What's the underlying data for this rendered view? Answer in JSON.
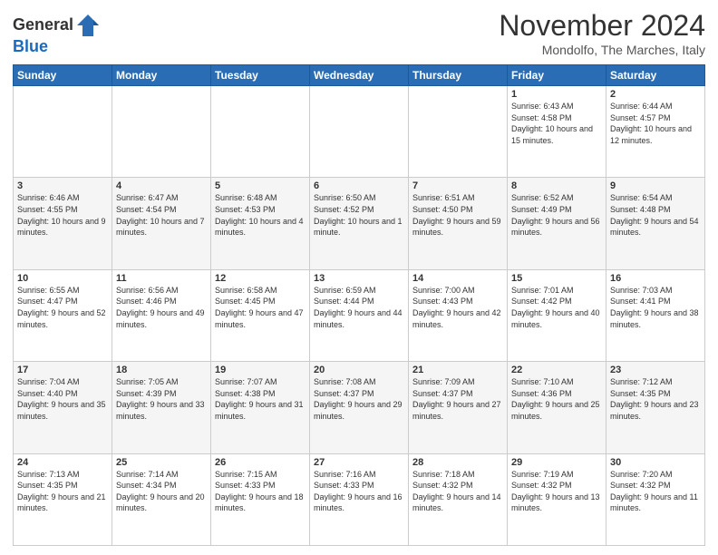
{
  "header": {
    "logo_general": "General",
    "logo_blue": "Blue",
    "month_title": "November 2024",
    "location": "Mondolfo, The Marches, Italy"
  },
  "weekdays": [
    "Sunday",
    "Monday",
    "Tuesday",
    "Wednesday",
    "Thursday",
    "Friday",
    "Saturday"
  ],
  "weeks": [
    [
      {
        "day": "",
        "info": ""
      },
      {
        "day": "",
        "info": ""
      },
      {
        "day": "",
        "info": ""
      },
      {
        "day": "",
        "info": ""
      },
      {
        "day": "",
        "info": ""
      },
      {
        "day": "1",
        "info": "Sunrise: 6:43 AM\nSunset: 4:58 PM\nDaylight: 10 hours and 15 minutes."
      },
      {
        "day": "2",
        "info": "Sunrise: 6:44 AM\nSunset: 4:57 PM\nDaylight: 10 hours and 12 minutes."
      }
    ],
    [
      {
        "day": "3",
        "info": "Sunrise: 6:46 AM\nSunset: 4:55 PM\nDaylight: 10 hours and 9 minutes."
      },
      {
        "day": "4",
        "info": "Sunrise: 6:47 AM\nSunset: 4:54 PM\nDaylight: 10 hours and 7 minutes."
      },
      {
        "day": "5",
        "info": "Sunrise: 6:48 AM\nSunset: 4:53 PM\nDaylight: 10 hours and 4 minutes."
      },
      {
        "day": "6",
        "info": "Sunrise: 6:50 AM\nSunset: 4:52 PM\nDaylight: 10 hours and 1 minute."
      },
      {
        "day": "7",
        "info": "Sunrise: 6:51 AM\nSunset: 4:50 PM\nDaylight: 9 hours and 59 minutes."
      },
      {
        "day": "8",
        "info": "Sunrise: 6:52 AM\nSunset: 4:49 PM\nDaylight: 9 hours and 56 minutes."
      },
      {
        "day": "9",
        "info": "Sunrise: 6:54 AM\nSunset: 4:48 PM\nDaylight: 9 hours and 54 minutes."
      }
    ],
    [
      {
        "day": "10",
        "info": "Sunrise: 6:55 AM\nSunset: 4:47 PM\nDaylight: 9 hours and 52 minutes."
      },
      {
        "day": "11",
        "info": "Sunrise: 6:56 AM\nSunset: 4:46 PM\nDaylight: 9 hours and 49 minutes."
      },
      {
        "day": "12",
        "info": "Sunrise: 6:58 AM\nSunset: 4:45 PM\nDaylight: 9 hours and 47 minutes."
      },
      {
        "day": "13",
        "info": "Sunrise: 6:59 AM\nSunset: 4:44 PM\nDaylight: 9 hours and 44 minutes."
      },
      {
        "day": "14",
        "info": "Sunrise: 7:00 AM\nSunset: 4:43 PM\nDaylight: 9 hours and 42 minutes."
      },
      {
        "day": "15",
        "info": "Sunrise: 7:01 AM\nSunset: 4:42 PM\nDaylight: 9 hours and 40 minutes."
      },
      {
        "day": "16",
        "info": "Sunrise: 7:03 AM\nSunset: 4:41 PM\nDaylight: 9 hours and 38 minutes."
      }
    ],
    [
      {
        "day": "17",
        "info": "Sunrise: 7:04 AM\nSunset: 4:40 PM\nDaylight: 9 hours and 35 minutes."
      },
      {
        "day": "18",
        "info": "Sunrise: 7:05 AM\nSunset: 4:39 PM\nDaylight: 9 hours and 33 minutes."
      },
      {
        "day": "19",
        "info": "Sunrise: 7:07 AM\nSunset: 4:38 PM\nDaylight: 9 hours and 31 minutes."
      },
      {
        "day": "20",
        "info": "Sunrise: 7:08 AM\nSunset: 4:37 PM\nDaylight: 9 hours and 29 minutes."
      },
      {
        "day": "21",
        "info": "Sunrise: 7:09 AM\nSunset: 4:37 PM\nDaylight: 9 hours and 27 minutes."
      },
      {
        "day": "22",
        "info": "Sunrise: 7:10 AM\nSunset: 4:36 PM\nDaylight: 9 hours and 25 minutes."
      },
      {
        "day": "23",
        "info": "Sunrise: 7:12 AM\nSunset: 4:35 PM\nDaylight: 9 hours and 23 minutes."
      }
    ],
    [
      {
        "day": "24",
        "info": "Sunrise: 7:13 AM\nSunset: 4:35 PM\nDaylight: 9 hours and 21 minutes."
      },
      {
        "day": "25",
        "info": "Sunrise: 7:14 AM\nSunset: 4:34 PM\nDaylight: 9 hours and 20 minutes."
      },
      {
        "day": "26",
        "info": "Sunrise: 7:15 AM\nSunset: 4:33 PM\nDaylight: 9 hours and 18 minutes."
      },
      {
        "day": "27",
        "info": "Sunrise: 7:16 AM\nSunset: 4:33 PM\nDaylight: 9 hours and 16 minutes."
      },
      {
        "day": "28",
        "info": "Sunrise: 7:18 AM\nSunset: 4:32 PM\nDaylight: 9 hours and 14 minutes."
      },
      {
        "day": "29",
        "info": "Sunrise: 7:19 AM\nSunset: 4:32 PM\nDaylight: 9 hours and 13 minutes."
      },
      {
        "day": "30",
        "info": "Sunrise: 7:20 AM\nSunset: 4:32 PM\nDaylight: 9 hours and 11 minutes."
      }
    ]
  ]
}
